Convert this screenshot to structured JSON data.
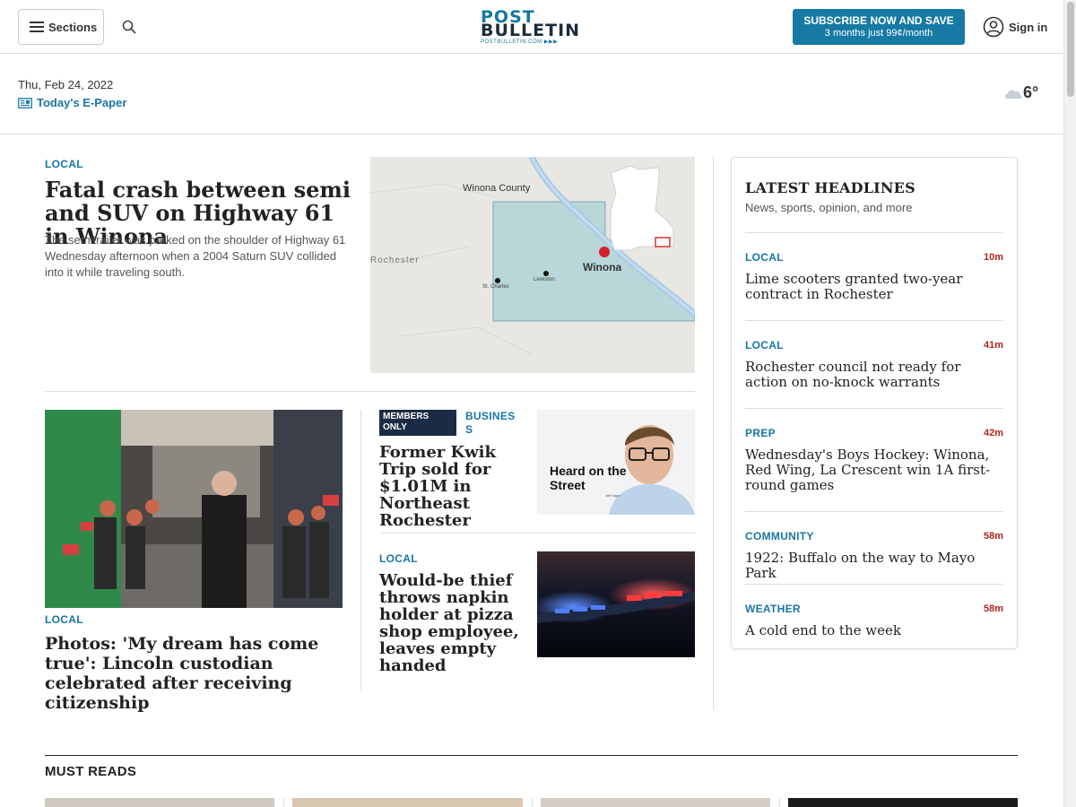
{
  "header": {
    "sections_label": "Sections",
    "logo": {
      "line1": "POST",
      "line2": "BULLETIN",
      "line3": "POSTBULLETIN.COM ▶▶▶"
    },
    "subscribe": {
      "title": "SUBSCRIBE NOW AND SAVE",
      "subtitle": "3 months just 99¢/month"
    },
    "signin_label": "Sign in"
  },
  "dateline": {
    "date": "Thu, Feb 24, 2022",
    "epaper_label": "Today's E-Paper"
  },
  "weather": {
    "temperature": "6°",
    "icon": "cloud-icon"
  },
  "lead_story": {
    "kicker": "LOCAL",
    "title": "Fatal crash between semi and SUV on Highway 61 in Winona",
    "summary": "The semitrailer was parked on the shoulder of Highway 61 Wednesday afternoon when a 2004 Saturn SUV collided into it while traveling south.",
    "map_labels": {
      "county": "Winona County",
      "city": "Winona",
      "rochester": "Rochester",
      "st_charles": "St. Charles",
      "lewiston": "Lewiston"
    }
  },
  "story2": {
    "kicker": "LOCAL",
    "title": "Photos: 'My dream has come true': Lincoln custodian celebrated after receiving citizenship"
  },
  "story3": {
    "badge": "MEMBERS ONLY",
    "kicker": "BUSINESS",
    "title": "Former Kwik Trip sold for $1.01M in Northeast Rochester",
    "image_text": "Heard on the Street",
    "image_caption": "Jeff Kiger"
  },
  "story4": {
    "kicker": "LOCAL",
    "title": "Would-be thief throws napkin holder at pizza shop employee, leaves empty handed"
  },
  "latest": {
    "title": "LATEST HEADLINES",
    "subtitle": "News, sports, opinion, and more",
    "items": [
      {
        "kicker": "LOCAL",
        "time": "10m",
        "headline": "Lime scooters granted two-year contract in Rochester"
      },
      {
        "kicker": "LOCAL",
        "time": "41m",
        "headline": "Rochester council not ready for action on no-knock warrants"
      },
      {
        "kicker": "PREP",
        "time": "42m",
        "headline": "Wednesday's Boys Hockey: Winona, Red Wing, La Crescent win 1A first-round games"
      },
      {
        "kicker": "COMMUNITY",
        "time": "58m",
        "headline": "1922: Buffalo on the way to Mayo Park"
      },
      {
        "kicker": "WEATHER",
        "time": "58m",
        "headline": "A cold end to the week"
      }
    ]
  },
  "must_reads": {
    "title": "MUST READS"
  },
  "colors": {
    "accent": "#1a76a5",
    "time": "#b5231c",
    "subscribe_bg": "#167aa5",
    "badge_bg": "#1a2b45"
  }
}
